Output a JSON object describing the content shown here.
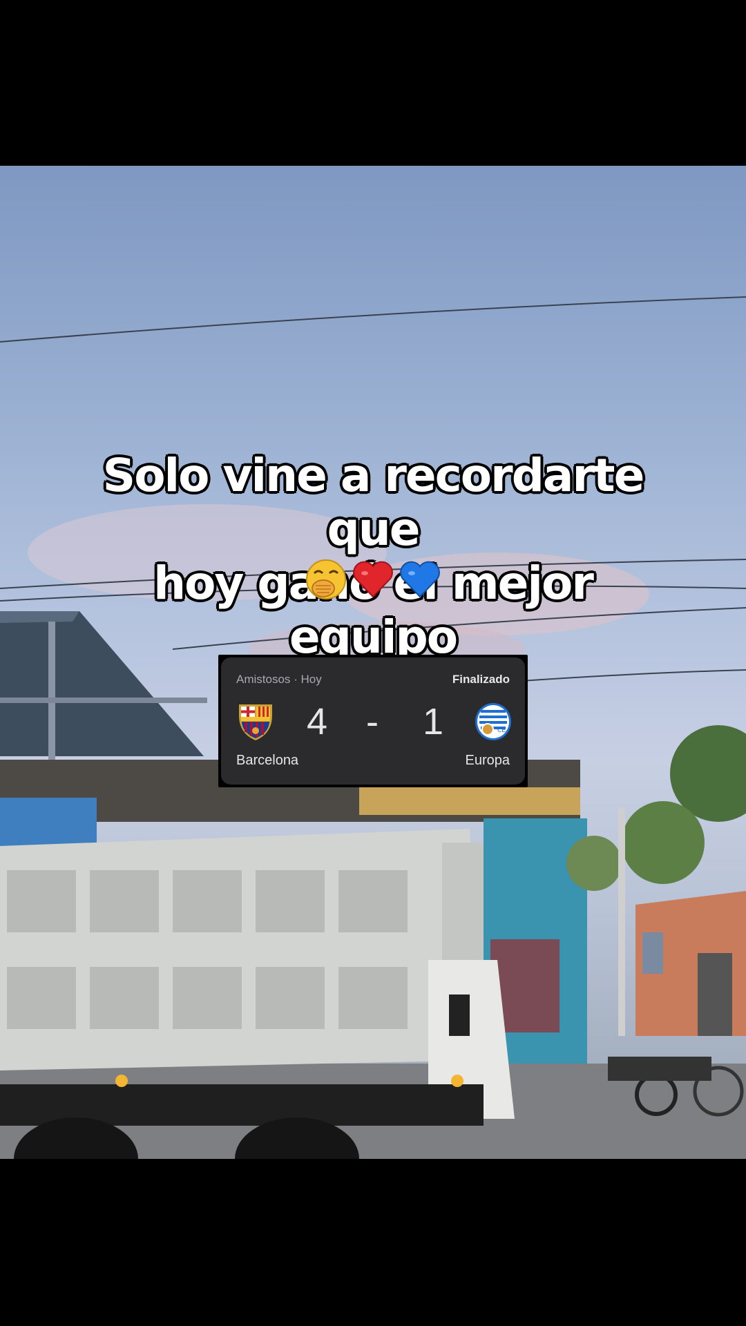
{
  "caption": {
    "line1": "Solo vine a recordarte que",
    "line2": "hoy ganó el mejor equipo",
    "emojis": [
      "hand-over-mouth-emoji",
      "red-heart-emoji",
      "blue-heart-emoji"
    ]
  },
  "match_card": {
    "competition": "Amistosos · Hoy",
    "status": "Finalizado",
    "home": {
      "name": "Barcelona",
      "score": "4",
      "crest": "fc-barcelona-crest-icon"
    },
    "separator": "-",
    "away": {
      "name": "Europa",
      "score": "1",
      "crest": "ce-europa-crest-icon"
    }
  },
  "colors": {
    "card_bg": "#2b2b2d",
    "caption_text": "#ffffff",
    "caption_outline": "#000000"
  }
}
